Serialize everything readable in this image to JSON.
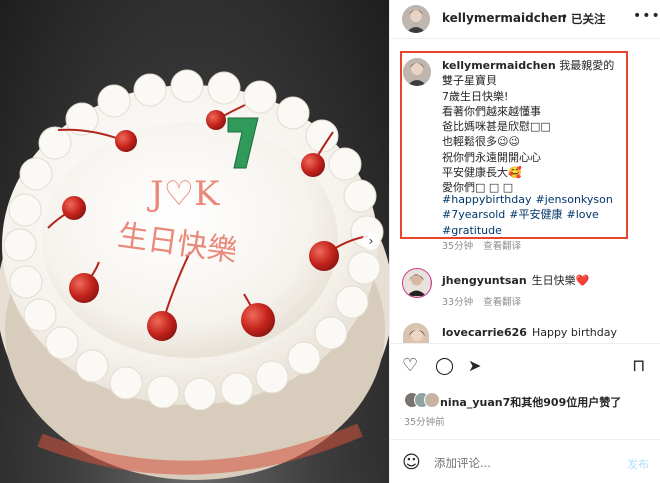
{
  "header": {
    "username": "kellymermaidchen",
    "separator": "•",
    "follow_label": "已关注",
    "more_icon": "•••"
  },
  "caption": {
    "username": "kellymermaidchen",
    "text": " 我最親愛的雙子星寶貝\n7歲生日快樂!\n看著你們越來越懂事\n爸比媽咪甚是欣慰□□\n也輕鬆很多😉😉\n祝你們永遠開開心心\n平安健康長大🥰\n愛你們□ □ □",
    "hashtags": [
      "#happybirthday",
      "#jensonkyson",
      "#7yearsold",
      "#平安健康",
      "#love",
      "#gratitude"
    ],
    "time": "35分钟",
    "reply": "查看翻译"
  },
  "comments": [
    {
      "username": "jhengyuntsan",
      "text": "生日快樂",
      "heart": "❤️",
      "time": "33分钟",
      "reply": "查看翻译"
    },
    {
      "username": "lovecarrie626",
      "text": "Happy birthday"
    }
  ],
  "actions": {
    "like_icon": "♡",
    "comment_icon": "◯",
    "share_icon": "➤",
    "save_icon": "⊓"
  },
  "likes": {
    "user": "nina_yuan7",
    "text": "和其他909位用户赞了"
  },
  "post_time": "35分钟前",
  "add_comment": {
    "placeholder": "添加评论...",
    "post_label": "发布",
    "emoji_icon": "☺"
  },
  "photo": {
    "cake_text_top": "J♡K",
    "cake_text_bottom": "生日快樂",
    "candle": "7"
  }
}
